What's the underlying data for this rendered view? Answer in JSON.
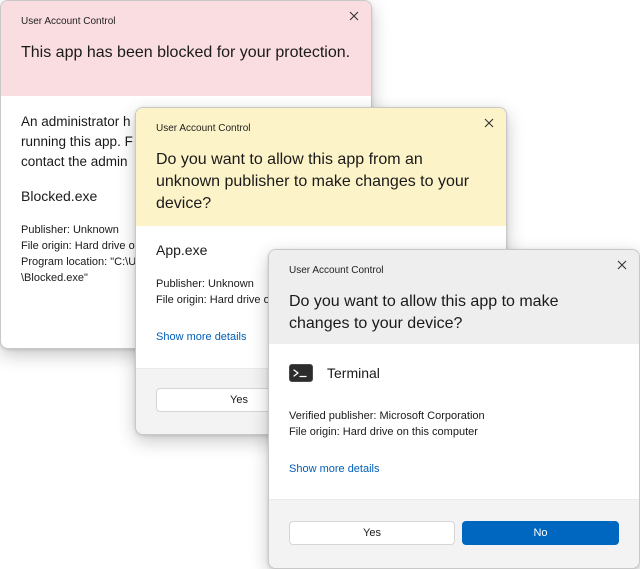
{
  "colors": {
    "blocked_header": "#fadde1",
    "unknown_header": "#fdf3c8",
    "verified_header": "#eeeeee",
    "accent": "#0067c0",
    "link": "#005fb8"
  },
  "blocked_dialog": {
    "caption": "User Account Control",
    "close_icon": "close-icon",
    "title": "This app has been blocked for your protection.",
    "description_lines": [
      "An administrator h",
      "running this app. F",
      "contact the admin"
    ],
    "app_name": "Blocked.exe",
    "publisher": "Publisher: Unknown",
    "file_origin": "File origin: Hard drive o",
    "program_location_line1": "Program location: \"C:\\U",
    "program_location_line2": "\\Blocked.exe\""
  },
  "unknown_dialog": {
    "caption": "User Account Control",
    "close_icon": "close-icon",
    "title": "Do you want to allow this app from an unknown publisher to make changes to your device?",
    "app_name": "App.exe",
    "publisher": "Publisher: Unknown",
    "file_origin": "File origin: Hard drive o",
    "show_more": "Show more details",
    "yes_label": "Yes"
  },
  "verified_dialog": {
    "caption": "User Account Control",
    "close_icon": "close-icon",
    "title": "Do you want to allow this app to make changes to your device?",
    "app_icon": "terminal-icon",
    "app_name": "Terminal",
    "publisher": "Verified publisher: Microsoft Corporation",
    "file_origin": "File origin: Hard drive on this computer",
    "show_more": "Show more details",
    "yes_label": "Yes",
    "no_label": "No"
  }
}
